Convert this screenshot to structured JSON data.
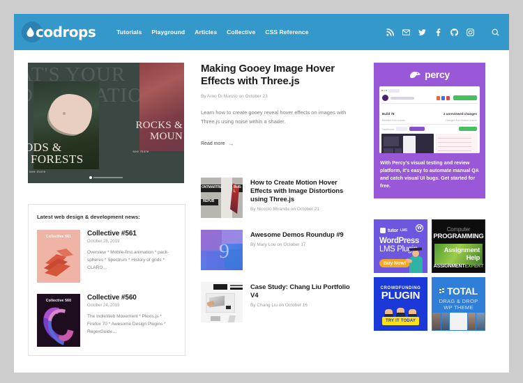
{
  "site": {
    "logo_text": "codrops",
    "logo_icon": "water-drop-icon"
  },
  "nav": {
    "items": [
      {
        "label": "Tutorials"
      },
      {
        "label": "Playground"
      },
      {
        "label": "Articles"
      },
      {
        "label": "Collective"
      },
      {
        "label": "CSS Reference"
      }
    ]
  },
  "social": {
    "items": [
      {
        "name": "rss-icon",
        "label": "RSS"
      },
      {
        "name": "email-icon",
        "label": "Email"
      },
      {
        "name": "twitter-icon",
        "label": "Twitter"
      },
      {
        "name": "facebook-icon",
        "label": "Facebook"
      },
      {
        "name": "github-icon",
        "label": "GitHub"
      },
      {
        "name": "instagram-icon",
        "label": "Instagram"
      }
    ],
    "search_label": "Search"
  },
  "hero": {
    "background_text_line1": "AT'S YOUR",
    "background_text_line2": "DESTINATION",
    "slide1_title_line1": "ODS &",
    "slide1_title_line2": "FORESTS",
    "slide1_more": "see more",
    "slide2_title_line1": "ROCKS &",
    "slide2_title_line2": "MOUN",
    "slide2_more": "see more"
  },
  "featured": {
    "title": "Making Gooey Image Hover Effects with Three.js",
    "byline": "By Arno Di Nunzio on October 23",
    "excerpt": "Learn how to create gooey reveal hover effects on images with Three.js using noise within a shader.",
    "read_more": "Read more",
    "read_more_arrow": "→"
  },
  "articles": {
    "items": [
      {
        "title": "How to Create Motion Hover Effects with Image Distortions using Three.js",
        "byline": "By Niccolò Miranda on October 21",
        "thumb": "montmartre-poster-thumbnail",
        "thumb_text_1": "ONTMARTRE",
        "thumb_text_2": "BUR-L",
        "thumb_text_3": "RÉPUB"
      },
      {
        "title": "Awesome Demos Roundup #9",
        "byline": "By Mary Lou on October 17",
        "thumb": "purple-collage-thumbnail",
        "thumb_text_1": "9"
      },
      {
        "title": "Case Study: Chang Liu Portfolio V4",
        "byline": "By Chang Liu on October 16",
        "thumb": "laptop-photo-thumbnail"
      }
    ]
  },
  "news": {
    "heading": "Latest web design & development news:",
    "items": [
      {
        "thumb_label": "Collective 561",
        "title": "Collective #561",
        "date": "October 28, 2019",
        "excerpt": "Overview * Mobile-first animation * pack-spheres * Spectrum * History of grids * CLARO…"
      },
      {
        "thumb_label": "Collective 560",
        "title": "Collective #560",
        "date": "October 24, 2019",
        "excerpt": "The IndieWeb Movement * Plexis.js * Firefox 70 * Awesome Design Plugins * RegexGuide…"
      }
    ]
  },
  "percy_ad": {
    "brand": "percy",
    "logo_icon": "percy-mascot-icon",
    "copy": "With Percy's visual testing and review platform, it's easy to automate manual QA and catch visual UI bugs. Get started for free.",
    "screenshot": {
      "build_label": "Build 78",
      "changes_label": "2 unreviewed changes",
      "baseline_label": "Baseline from master",
      "changes_from_label": "Changes from feature branch",
      "dashboard_label": "Dashboard",
      "approve_label": "Approve",
      "account_label": "archive / web-app"
    }
  },
  "ads": {
    "tutor": {
      "brand": "tutor",
      "brand_suffix": "LMS",
      "wp_badge": "W",
      "line1": "WordPress",
      "line2_bold": "LMS",
      "line2_light": "Plugin",
      "cta": "Buy Now!"
    },
    "assignment": {
      "line1": "Computer",
      "line2": "PROGRAMMING",
      "line3": "Assignment",
      "line4": "Help",
      "brand_a": "ASSIGNMENT",
      "brand_b": "EXPERT"
    },
    "crowdfunding": {
      "line1": "CROWDFUNDING",
      "line2": "PLUGIN",
      "cta": "TRY IT TODAY"
    },
    "total": {
      "name": "TOTAL",
      "line2": "DRAG & DROP",
      "line3": "WP THEME"
    }
  },
  "colors": {
    "header_blue": "#3498ca",
    "percy_purple": "#9858d8",
    "tutor_purple": "#6d56e0",
    "crowd_blue": "#1a39d8",
    "total_blue": "#2f7fd8",
    "page_bg": "#cdcdcd"
  }
}
